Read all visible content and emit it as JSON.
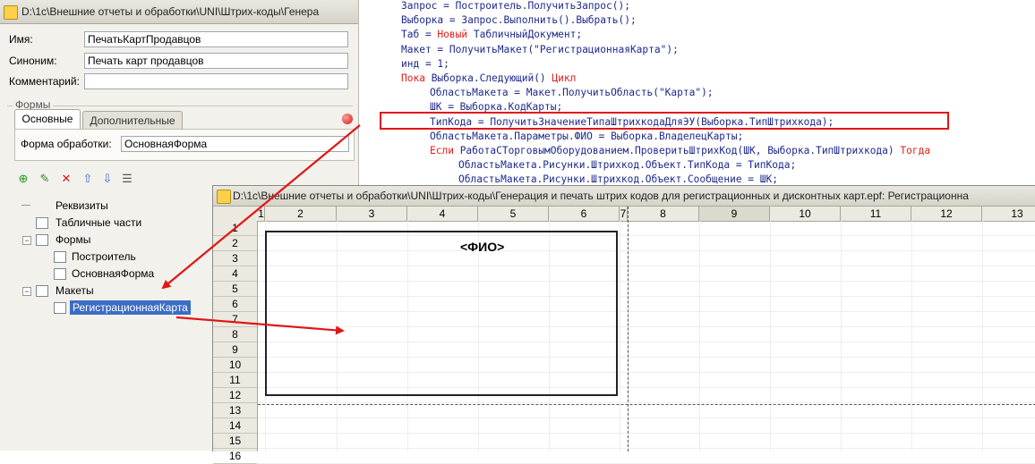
{
  "left_window": {
    "title": "D:\\1c\\Внешние отчеты и обработки\\UNI\\Штрих-коды\\Генера",
    "fields": [
      {
        "label": "Имя:",
        "value": "ПечатьКартПродавцов"
      },
      {
        "label": "Синоним:",
        "value": "Печать карт продавцов"
      },
      {
        "label": "Комментарий:",
        "value": ""
      }
    ],
    "forms_group": {
      "title": "Формы",
      "tabs": [
        "Основные",
        "Дополнительные"
      ],
      "form_label": "Форма обработки:",
      "form_value": "ОсновнаяФорма"
    },
    "toolbar_icons": [
      "add-icon",
      "edit-icon",
      "delete-icon",
      "move-up-icon",
      "move-down-icon",
      "list-icon"
    ],
    "tree": {
      "attributes": "Реквизиты",
      "tabular_parts": "Табличные части",
      "forms": "Формы",
      "form_builder": "Построитель",
      "form_main": "ОсновнаяФорма",
      "layouts": "Макеты",
      "layout_card": "РегистрационнаяКарта"
    }
  },
  "code": {
    "lines": [
      {
        "indent": 0,
        "segments": [
          {
            "t": "Запрос = Построитель.ПолучитьЗапрос();",
            "k": false
          }
        ]
      },
      {
        "indent": 0,
        "segments": [
          {
            "t": "Выборка = Запрос.Выполнить().Выбрать();",
            "k": false
          }
        ]
      },
      {
        "indent": 0,
        "segments": [
          {
            "t": "Таб = ",
            "k": false
          },
          {
            "t": "Новый",
            "k": true
          },
          {
            "t": " ТабличныйДокумент;",
            "k": false
          }
        ]
      },
      {
        "indent": 0,
        "segments": [
          {
            "t": "Макет = ПолучитьМакет(\"РегистрационнаяКарта\");",
            "k": false
          }
        ]
      },
      {
        "indent": 0,
        "segments": [
          {
            "t": "инд = 1;",
            "k": false
          }
        ]
      },
      {
        "indent": 0,
        "segments": [
          {
            "t": "Пока",
            "k": true
          },
          {
            "t": " Выборка.Следующий() ",
            "k": false
          },
          {
            "t": "Цикл",
            "k": true
          }
        ]
      },
      {
        "indent": 1,
        "segments": [
          {
            "t": "ОбластьМакета = Макет.ПолучитьОбласть(\"Карта\");",
            "k": false
          }
        ]
      },
      {
        "indent": 1,
        "segments": [
          {
            "t": "ШК = Выборка.КодКарты;",
            "k": false
          }
        ]
      },
      {
        "indent": 1,
        "segments": [
          {
            "t": "ТипКода = ПолучитьЗначениеТипаШтрихкодаДляЭУ(Выборка.ТипШтрихкода);",
            "k": false
          }
        ]
      },
      {
        "indent": 1,
        "segments": [
          {
            "t": "ОбластьМакета.Параметры.ФИО = Выборка.ВладелецКарты;",
            "k": false
          }
        ]
      },
      {
        "indent": 1,
        "segments": [
          {
            "t": "Если",
            "k": true
          },
          {
            "t": " РаботаСТорговымОборудованием.ПроверитьШтрихКод(ШК, Выборка.ТипШтрихкода) ",
            "k": false
          },
          {
            "t": "Тогда",
            "k": true
          }
        ]
      },
      {
        "indent": 2,
        "segments": [
          {
            "t": "ОбластьМакета.Рисунки.Штрихкод.Объект.ТипКода = ТипКода;",
            "k": false
          }
        ]
      },
      {
        "indent": 2,
        "segments": [
          {
            "t": "ОбластьМакета.Рисунки.Штрихкод.Объект.Сообщение = ШК;",
            "k": false
          }
        ]
      }
    ]
  },
  "sheet_window": {
    "title": "D:\\1c\\Внешние отчеты и обработки\\UNI\\Штрих-коды\\Генерация и печать штрих кодов для регистрационных и дисконтных карт.epf: Регистрационна",
    "columns": [
      "1",
      "2",
      "3",
      "4",
      "5",
      "6",
      "7",
      "8",
      "9",
      "10",
      "11",
      "12",
      "13"
    ],
    "selected_column": "9",
    "rows": [
      "1",
      "2",
      "3",
      "4",
      "5",
      "6",
      "7",
      "8",
      "9",
      "10",
      "11",
      "12",
      "13",
      "14",
      "15",
      "16"
    ],
    "card_parameter": "<ФИО>"
  },
  "colors": {
    "keyword": "#e0201c",
    "code_text": "#1e2a8c",
    "highlight_border": "#e01515",
    "arrow": "#e01515",
    "selection": "#3c6dc4"
  }
}
